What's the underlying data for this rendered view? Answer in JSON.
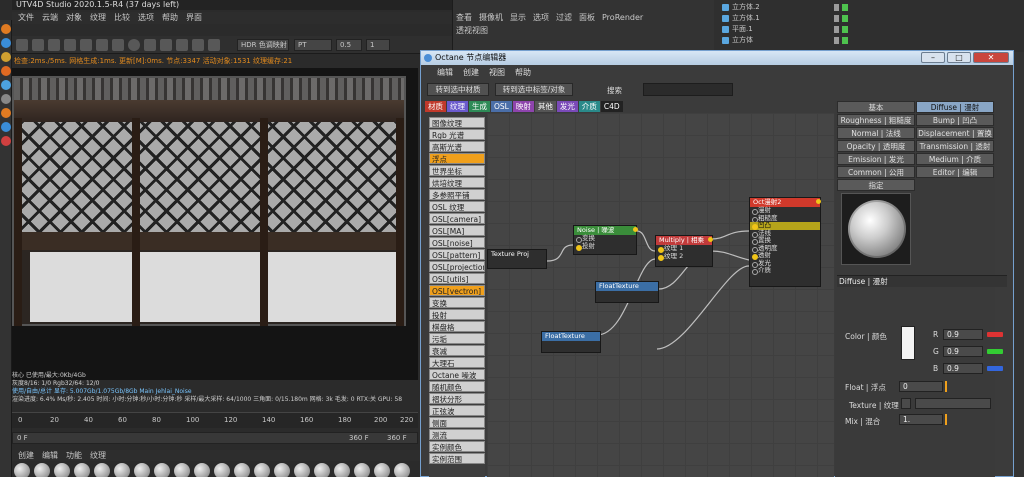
{
  "app": {
    "title": "UTV4D Studio 2020.1.5-R4 (37 days left)"
  },
  "main_menu": [
    "文件",
    "云端",
    "对象",
    "纹理",
    "比较",
    "选项",
    "帮助",
    "界面"
  ],
  "toolbar": {
    "hdr_mode": "HDR 色调映射",
    "pt_mode": "PT",
    "zoom": "0.5",
    "count": "1"
  },
  "render_status": "检查:2ms./5ms. 网格生成:1ms. 更新[M]:0ms. 节点:3347 活动对象:1531 纹理缓存:21",
  "stats": [
    "核心 已使用/最大:0Kb/4Gb",
    "灰度8/16: 1/0          Rgb32/64: 12/0",
    "使用/自由/总计 显存: 5.007Gb/1.075Gb/8Gb   Main  Jehlai_Noise",
    "渲染进度: 6.4%  Ms/秒: 2.405  时间: 小时:分钟:秒/小时:分钟:秒  采样/最大采样: 64/1000  三角面: 0/15.180m  网格: 3k  毛发: 0  RTX:关  GPU: 58"
  ],
  "timeline": {
    "ticks": [
      "0",
      "20",
      "40",
      "60",
      "80",
      "100",
      "120",
      "140",
      "160",
      "180",
      "200",
      "220"
    ],
    "start": "0 F",
    "end": "360 F",
    "end2": "360 F"
  },
  "material_menu": [
    "创建",
    "编辑",
    "功能",
    "纹理"
  ],
  "mid_menu": [
    "查看",
    "摄像机",
    "显示",
    "选项",
    "过滤",
    "面板",
    "ProRender"
  ],
  "mid_tab": "透视视图",
  "objects": [
    "立方体.2",
    "立方体.1",
    "平面.1",
    "立方体"
  ],
  "octane": {
    "title": "Octane 节点编辑器",
    "menu": [
      "编辑",
      "创建",
      "视图",
      "帮助"
    ],
    "btn_material": "转到选中材质",
    "btn_tag": "转到选中标签/对象",
    "search_label": "搜索",
    "categories": [
      {
        "label": "材质",
        "color": "#c0392b"
      },
      {
        "label": "纹理",
        "color": "#6a5acd"
      },
      {
        "label": "生成",
        "color": "#2e8b57"
      },
      {
        "label": "OSL",
        "color": "#4a6ea8"
      },
      {
        "label": "映射",
        "color": "#8e44ad"
      },
      {
        "label": "其他",
        "color": "#555555"
      },
      {
        "label": "发光",
        "color": "#7a4ab8"
      },
      {
        "label": "介质",
        "color": "#2a8a8a"
      },
      {
        "label": "C4D",
        "color": "#222222"
      }
    ],
    "node_types": [
      "图像纹理",
      "Rgb 光谱",
      "高斯光谱",
      "浮点",
      "世界坐标",
      "烘培纹理",
      "多参照平铺",
      "OSL 纹理",
      "OSL[camera]",
      "OSL[MA]",
      "OSL[noise]",
      "OSL[pattern]",
      "OSL[projection]",
      "OSL[utils]",
      "OSL[vectron]",
      "变换",
      "投射",
      "棋盘格",
      "污垢",
      "衰减",
      "大理石",
      "Octane 噪波",
      "随机颜色",
      "褶状分形",
      "正弦波",
      "侧面",
      "测流",
      "实例颜色",
      "实例范围"
    ],
    "selected_types": [
      "浮点",
      "OSL[vectron]"
    ],
    "nodes": {
      "texture_proj": {
        "title": "Texture Proj"
      },
      "noise": {
        "title": "Noise | 噪波",
        "rows": [
          "变换",
          "投射"
        ]
      },
      "multiply": {
        "title": "Multiply | 相乘",
        "rows": [
          "纹理 1",
          "纹理 2"
        ]
      },
      "oct": {
        "title": "Oct漫射2",
        "rows": [
          "漫射",
          "粗糙度",
          "凹凸",
          "法线",
          "置换",
          "透明度",
          "透射",
          "发光",
          "介质"
        ]
      },
      "float1": {
        "title": "FloatTexture"
      },
      "float2": {
        "title": "FloatTexture"
      }
    },
    "tabs": [
      "基本",
      "Diffuse | 漫射",
      "Roughness | 粗糙度",
      "Bump | 凹凸",
      "Normal | 法线",
      "Displacement | 置换",
      "Opacity | 透明度",
      "Transmission | 透射",
      "Emission | 发光",
      "Medium | 介质",
      "Common | 公用",
      "Editor | 编辑",
      "指定"
    ],
    "selected_tab": "Diffuse | 漫射",
    "section": "Diffuse | 漫射",
    "color_label": "Color | 颜色",
    "r_label": "R",
    "g_label": "G",
    "b_label": "B",
    "r": "0.9",
    "g": "0.9",
    "b": "0.9",
    "float_label": "Float | 浮点",
    "float_value": "0",
    "texture_label": "Texture | 纹理",
    "mix_label": "Mix | 混合",
    "mix_value": "1."
  }
}
